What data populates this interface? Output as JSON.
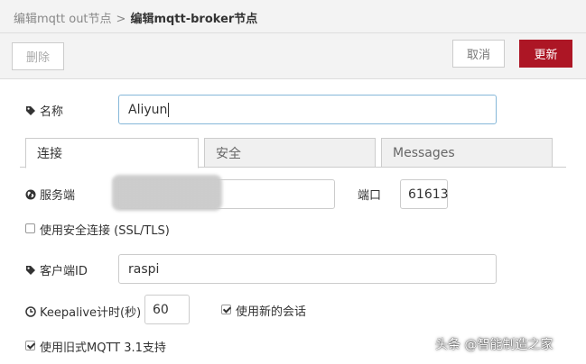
{
  "breadcrumb": {
    "previous": "编辑mqtt out节点",
    "separator": ">",
    "current": "编辑mqtt-broker节点"
  },
  "toolbar": {
    "delete_label": "删除",
    "cancel_label": "取消",
    "update_label": "更新"
  },
  "colors": {
    "primary": "#ad1625",
    "focus_border": "#85b7d9"
  },
  "form": {
    "name": {
      "label": "名称",
      "value": "Aliyun",
      "icon": "tag-icon"
    },
    "tabs": [
      {
        "label": "连接",
        "active": true
      },
      {
        "label": "安全",
        "active": false
      },
      {
        "label": "Messages",
        "active": false
      }
    ],
    "server": {
      "label": "服务端",
      "icon": "globe-icon",
      "value": ""
    },
    "port": {
      "label": "端口",
      "value": "61613"
    },
    "use_tls": {
      "label": "使用安全连接 (SSL/TLS)",
      "checked": false
    },
    "client_id": {
      "label": "客户端ID",
      "value": "raspi",
      "icon": "tag-icon"
    },
    "keepalive": {
      "label": "Keepalive计时(秒)",
      "value": "60",
      "icon": "clock-icon"
    },
    "clean_session": {
      "label": "使用新的会话",
      "checked": true
    },
    "legacy_mqtt": {
      "label": "使用旧式MQTT 3.1支持",
      "checked": true
    }
  },
  "source_caption": "头条 @智能制造之家"
}
